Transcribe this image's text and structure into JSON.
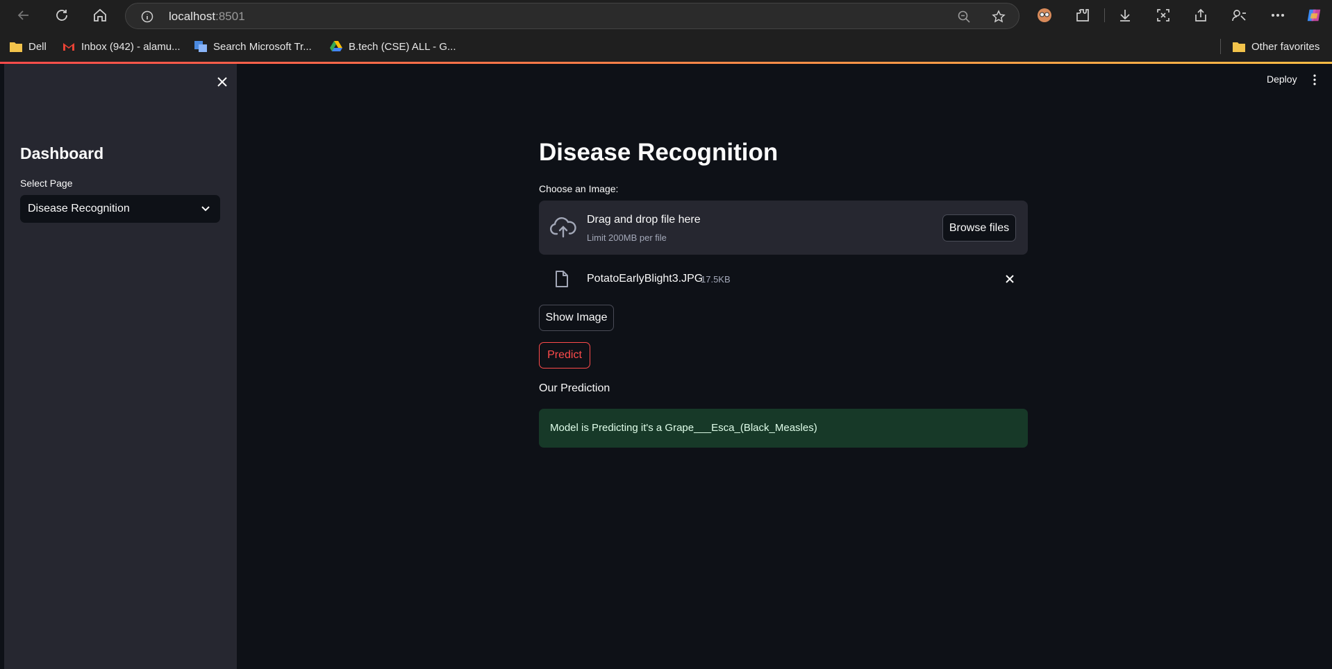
{
  "browser": {
    "url_host": "localhost",
    "url_port": ":8501",
    "bookmarks": [
      {
        "label": "Dell",
        "icon": "folder-icon"
      },
      {
        "label": "Inbox (942) - alamu...",
        "icon": "gmail-icon"
      },
      {
        "label": "Search Microsoft Tr...",
        "icon": "translator-icon"
      },
      {
        "label": "B.tech (CSE) ALL - G...",
        "icon": "google-drive-icon"
      }
    ],
    "other_favorites": "Other favorites"
  },
  "app": {
    "deploy_label": "Deploy",
    "accent_color": "#ff4b4b"
  },
  "sidebar": {
    "title": "Dashboard",
    "select_label": "Select Page",
    "select_value": "Disease Recognition"
  },
  "main": {
    "title": "Disease Recognition",
    "uploader_label": "Choose an Image:",
    "dropzone_text": "Drag and drop file here",
    "dropzone_limit": "Limit 200MB per file",
    "browse_label": "Browse files",
    "file_name": "PotatoEarlyBlight3.JPG",
    "file_size": "17.5KB",
    "show_image_label": "Show Image",
    "predict_label": "Predict",
    "prediction_heading": "Our Prediction",
    "prediction_text": "Model is Predicting it's a Grape___Esca_(Black_Measles)"
  }
}
